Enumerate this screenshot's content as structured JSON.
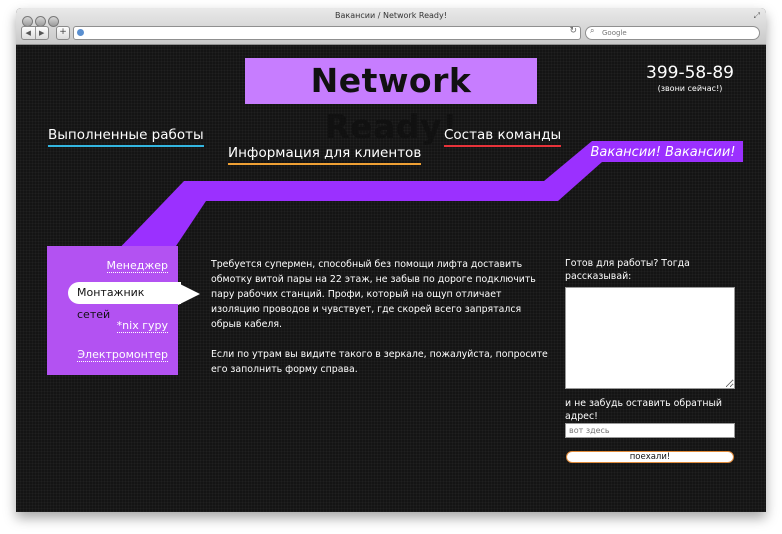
{
  "window": {
    "title": "Вакансии / Network Ready!"
  },
  "browser": {
    "search_placeholder": "Google"
  },
  "header": {
    "logo": "Network Ready!",
    "phone": "399-58-89",
    "phone_note": "(звони сейчас!)"
  },
  "nav": {
    "works": "Выполненные работы",
    "clients": "Информация для клиентов",
    "team": "Состав команды",
    "vacancies": "Вакансии! Вакансии!"
  },
  "sidebar": {
    "items": [
      {
        "label": "Менеджер"
      },
      {
        "label": "Монтажник сетей"
      },
      {
        "label": "*nix гуру"
      },
      {
        "label": "Электромонтер"
      }
    ]
  },
  "content": {
    "p1": "Требуется супермен, способный без помощи лифта доставить обмотку витой пары на 22 этаж, не забыв по дороге подключить пару рабочих станций. Профи, который на ощуп отличает изоляцию проводов и чувствует, где скорей всего запрятался обрыв кабеля.",
    "p2": "Если по утрам вы видите такого в зеркале, пожалуйста, попросите его заполнить форму справа."
  },
  "form": {
    "label_ready": "Готов для работы? Тогда рассказывай:",
    "label_address": "и не забудь оставить обратный адрес!",
    "address_placeholder": "вот здесь",
    "submit": "поехали!"
  },
  "colors": {
    "accent_purple": "#c77dff",
    "sidebar_purple": "#b352f2",
    "ribbon_purple": "#9b30ff",
    "underline_blue": "#33b6e0",
    "underline_orange": "#f0a135",
    "underline_red": "#e8333a"
  }
}
